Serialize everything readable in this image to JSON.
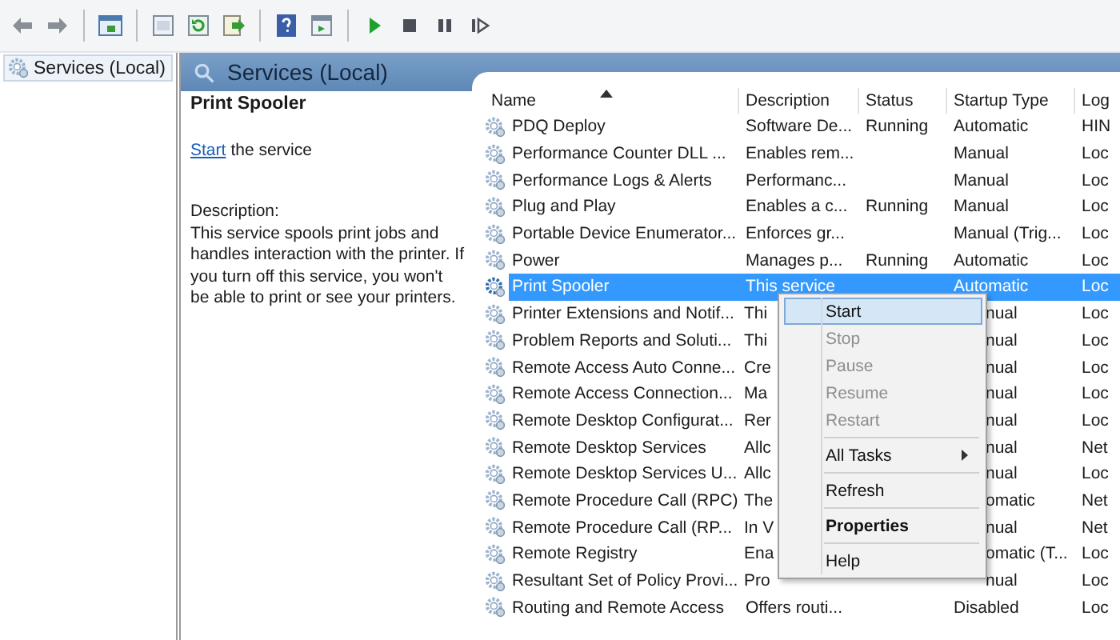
{
  "tree": {
    "items": [
      {
        "label": "Services (Local)",
        "selected": true
      }
    ]
  },
  "panel": {
    "title": "Services (Local)"
  },
  "details": {
    "service_name": "Print Spooler",
    "action_link": "Start",
    "action_text": "the service",
    "description_label": "Description:",
    "description": "This service spools print jobs and handles interaction with the printer. If you turn off this service, you won't be able to print or see your printers."
  },
  "table": {
    "columns": [
      {
        "label": "Name",
        "sorted": true
      },
      {
        "label": "Description"
      },
      {
        "label": "Status"
      },
      {
        "label": "Startup Type"
      },
      {
        "label": "Log"
      }
    ],
    "rows": [
      {
        "name": "PDQ Deploy",
        "description": "Software De...",
        "status": "Running",
        "startup": "Automatic",
        "log_on": "HIN",
        "selected": false,
        "under_menu": false
      },
      {
        "name": "Performance Counter DLL ...",
        "description": "Enables rem...",
        "startup": "Manual",
        "log_on": "Loc",
        "selected": false,
        "under_menu": false
      },
      {
        "name": "Performance Logs & Alerts",
        "description": "Performanc...",
        "startup": "Manual",
        "log_on": "Loc",
        "selected": false,
        "under_menu": false
      },
      {
        "name": "Plug and Play",
        "description": "Enables a c...",
        "status": "Running",
        "startup": "Manual",
        "log_on": "Loc",
        "selected": false,
        "under_menu": false
      },
      {
        "name": "Portable Device Enumerator...",
        "description": "Enforces gr...",
        "startup": "Manual (Trig...",
        "log_on": "Loc",
        "selected": false,
        "under_menu": false
      },
      {
        "name": "Power",
        "description": "Manages p...",
        "status": "Running",
        "startup": "Automatic",
        "log_on": "Loc",
        "selected": false,
        "under_menu": false
      },
      {
        "name": "Print Spooler",
        "description": "This service",
        "startup": "Automatic",
        "log_on": "Loc",
        "selected": true,
        "under_menu": false
      },
      {
        "name": "Printer Extensions and Notif...",
        "description": "Thi",
        "startup": "nual",
        "log_on": "Loc",
        "selected": false,
        "under_menu": true
      },
      {
        "name": "Problem Reports and Soluti...",
        "description": "Thi",
        "startup": "nual",
        "log_on": "Loc",
        "selected": false,
        "under_menu": true
      },
      {
        "name": "Remote Access Auto Conne...",
        "description": "Cre",
        "startup": "nual",
        "log_on": "Loc",
        "selected": false,
        "under_menu": true
      },
      {
        "name": "Remote Access Connection...",
        "description": "Ma",
        "startup": "nual",
        "log_on": "Loc",
        "selected": false,
        "under_menu": true
      },
      {
        "name": "Remote Desktop Configurat...",
        "description": "Rer",
        "startup": "nual",
        "log_on": "Loc",
        "selected": false,
        "under_menu": true
      },
      {
        "name": "Remote Desktop Services",
        "description": "Allc",
        "startup": "nual",
        "log_on": "Net",
        "selected": false,
        "under_menu": true
      },
      {
        "name": "Remote Desktop Services U...",
        "description": "Allc",
        "startup": "nual",
        "log_on": "Loc",
        "selected": false,
        "under_menu": true
      },
      {
        "name": "Remote Procedure Call (RPC)",
        "description": "The",
        "startup": "omatic",
        "log_on": "Net",
        "selected": false,
        "under_menu": true
      },
      {
        "name": "Remote Procedure Call (RP...",
        "description": "In V",
        "startup": "nual",
        "log_on": "Net",
        "selected": false,
        "under_menu": true
      },
      {
        "name": "Remote Registry",
        "description": "Ena",
        "startup": "omatic (T...",
        "log_on": "Loc",
        "selected": false,
        "under_menu": true
      },
      {
        "name": "Resultant Set of Policy Provi...",
        "description": "Pro",
        "startup": "nual",
        "log_on": "Loc",
        "selected": false,
        "under_menu": true
      },
      {
        "name": "Routing and Remote Access",
        "description": "Offers routi...",
        "startup": "Disabled",
        "log_on": "Loc",
        "selected": false,
        "under_menu": false
      }
    ]
  },
  "context_menu": {
    "items": [
      {
        "label": "Start",
        "selected": true,
        "disabled": false
      },
      {
        "label": "Stop",
        "selected": false,
        "disabled": true
      },
      {
        "label": "Pause",
        "selected": false,
        "disabled": true
      },
      {
        "label": "Resume",
        "selected": false,
        "disabled": true
      },
      {
        "label": "Restart",
        "selected": false,
        "disabled": true
      },
      {
        "label": "All Tasks",
        "selected": false,
        "disabled": false,
        "separator_before": true,
        "submenu": true
      },
      {
        "label": "Refresh",
        "selected": false,
        "disabled": false,
        "separator_before": true
      },
      {
        "label": "Properties",
        "selected": false,
        "disabled": false,
        "separator_before": true,
        "emphasis": true
      },
      {
        "label": "Help",
        "selected": false,
        "disabled": false,
        "separator_before": true
      }
    ]
  }
}
